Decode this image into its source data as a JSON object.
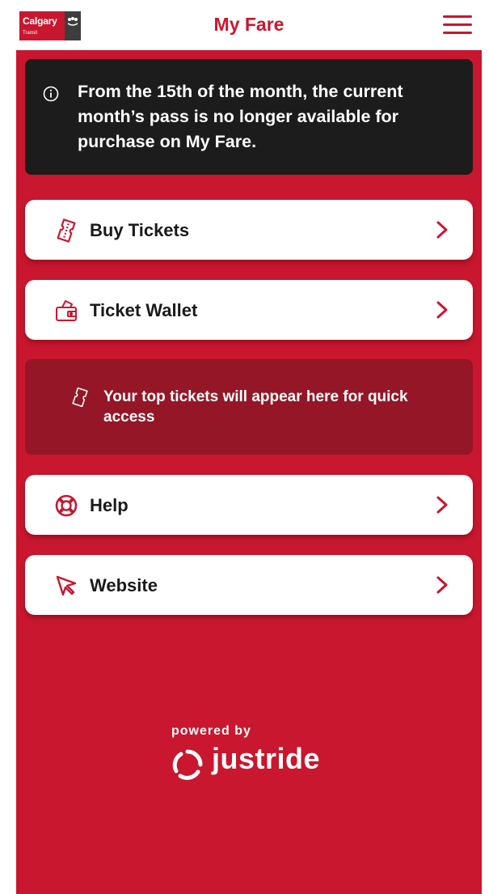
{
  "header": {
    "logo_text": "Calgary",
    "logo_sub": "Transit",
    "title": "My Fare",
    "menu_icon": "hamburger-menu-icon"
  },
  "notice": {
    "icon": "info-icon",
    "text": "From the 15th of the month, the current month’s pass is no longer available for purchase on My Fare."
  },
  "menu": {
    "items": [
      {
        "label": "Buy Tickets",
        "icon": "ticket-icon"
      },
      {
        "label": "Ticket Wallet",
        "icon": "wallet-icon"
      },
      {
        "label": "Help",
        "icon": "lifebuoy-icon"
      },
      {
        "label": "Website",
        "icon": "cursor-arrow-icon"
      }
    ]
  },
  "top_tickets": {
    "icon": "ticket-icon",
    "text": "Your top tickets will appear here for quick access"
  },
  "footer": {
    "powered_by": "powered by",
    "brand": "justride"
  },
  "colors": {
    "brand_red": "#c8172e",
    "dark_red_panel": "#951626",
    "notice_bg": "#1c1c1c",
    "card_bg": "#ffffff"
  }
}
